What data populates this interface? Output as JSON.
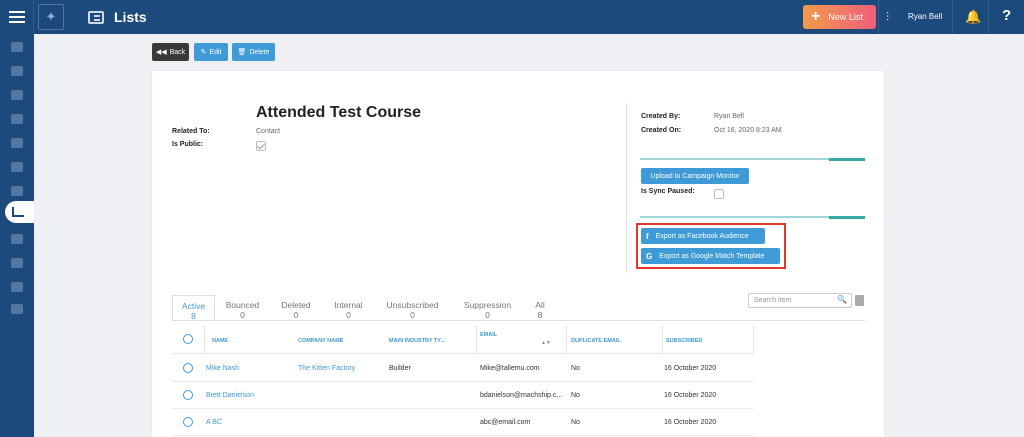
{
  "header": {
    "title": "Lists",
    "new_list_label": "New List",
    "user_name": "Ryan Bell",
    "help_label": "?"
  },
  "toolbar": {
    "back_label": "Back",
    "edit_label": "Edit",
    "delete_label": "Delete"
  },
  "record": {
    "title": "Attended Test Course",
    "related_to_label": "Related To:",
    "related_to_value": "Contact",
    "is_public_label": "Is Public:",
    "is_public_checked": true,
    "created_by_label": "Created By:",
    "created_by_value": "Ryan Bell",
    "created_on_label": "Created On:",
    "created_on_value": "Oct 16, 2020 8:23 AM",
    "upload_cm_label": "Upload to Campaign Monitor",
    "sync_paused_label": "Is Sync Paused:",
    "sync_paused_checked": false,
    "export_facebook_label": "Export as Facebook Audience",
    "export_google_label": "Export as Google Match Template"
  },
  "tabs": [
    {
      "label": "Active",
      "count": "8"
    },
    {
      "label": "Bounced",
      "count": "0"
    },
    {
      "label": "Deleted",
      "count": "0"
    },
    {
      "label": "Internal",
      "count": "0"
    },
    {
      "label": "Unsubscribed",
      "count": "0"
    },
    {
      "label": "Suppression",
      "count": "0"
    },
    {
      "label": "All",
      "count": "8"
    }
  ],
  "search": {
    "placeholder": "Search item"
  },
  "table": {
    "columns": [
      "NAME",
      "COMPANY NAME",
      "MAIN INDUSTRY TY...",
      "EMAIL",
      "DUPLICATE EMAIL",
      "SUBSCRIBED"
    ],
    "rows": [
      [
        "Mike Nash",
        "The Kitten Factory",
        "Builder",
        "Mike@tallemu.com",
        "No",
        "16 October 2020"
      ],
      [
        "Brett Danielson",
        "",
        "",
        "bdanielson@machship.c...",
        "No",
        "16 October 2020"
      ],
      [
        "A BC",
        "",
        "",
        "abc@email.com",
        "No",
        "16 October 2020"
      ]
    ]
  },
  "colors": {
    "topbar": "#1c4a7c",
    "primary_button": "#3f9ad8",
    "highlight_box": "#e03a2f"
  }
}
